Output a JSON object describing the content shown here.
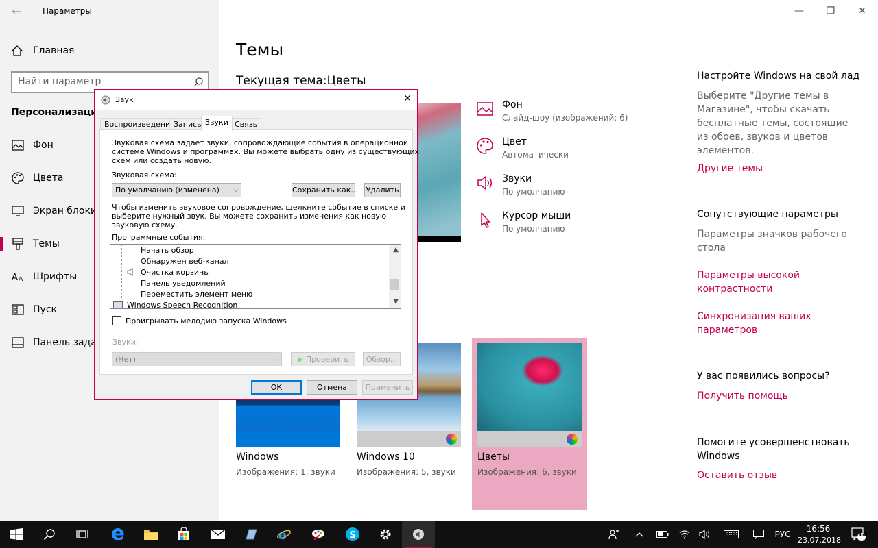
{
  "window": {
    "title": "Параметры",
    "back_glyph": "←",
    "minimize_glyph": "—",
    "maximize_glyph": "❐",
    "close_glyph": "✕"
  },
  "sidebar": {
    "home_label": "Главная",
    "search_placeholder": "Найти параметр",
    "section_title": "Персонализация",
    "items": [
      {
        "label": "Фон",
        "icon": "image-icon"
      },
      {
        "label": "Цвета",
        "icon": "palette-icon"
      },
      {
        "label": "Экран блокировки",
        "icon": "monitor-lock-icon"
      },
      {
        "label": "Темы",
        "icon": "brush-icon",
        "active": true
      },
      {
        "label": "Шрифты",
        "icon": "font-icon"
      },
      {
        "label": "Пуск",
        "icon": "start-icon"
      },
      {
        "label": "Панель задач",
        "icon": "taskbar-icon"
      }
    ]
  },
  "main": {
    "title": "Темы",
    "current_theme": "Текущая тема:Цветы",
    "properties": [
      {
        "title": "Фон",
        "sub": "Слайд-шоу (изображений: 6)",
        "icon": "image-icon"
      },
      {
        "title": "Цвет",
        "sub": "Автоматически",
        "icon": "palette-icon"
      },
      {
        "title": "Звуки",
        "sub": "По умолчанию",
        "icon": "speaker-icon"
      },
      {
        "title": "Курсор мыши",
        "sub": "По умолчанию",
        "icon": "cursor-icon"
      }
    ],
    "themes": [
      {
        "name": "Windows",
        "desc": "Изображения: 1, звуки"
      },
      {
        "name": "Windows 10",
        "desc": "Изображения: 5, звуки"
      },
      {
        "name": "Цветы",
        "desc": "Изображения: 6, звуки",
        "selected": true
      }
    ]
  },
  "right": {
    "customize_head": "Настройте Windows на свой лад",
    "customize_text": "Выберите \"Другие темы в Магазине\", чтобы скачать бесплатные темы, состоящие из обоев, звуков и цветов элементов.",
    "more_themes_link": "Другие темы",
    "related_head": "Сопутствующие параметры",
    "desktop_icons_text": "Параметры значков рабочего стола",
    "high_contrast_link": "Параметры высокой контрастности",
    "sync_link": "Синхронизация ваших параметров",
    "questions_head": "У вас появились вопросы?",
    "help_link": "Получить помощь",
    "improve_head": "Помогите усовершенствовать Windows",
    "feedback_link": "Оставить отзыв"
  },
  "dialog": {
    "title": "Звук",
    "close_glyph": "✕",
    "tabs": [
      "Воспроизведение",
      "Запись",
      "Звуки",
      "Связь"
    ],
    "active_tab": 2,
    "intro_lines": [
      "Звуковая схема задает звуки, сопровождающие события в операционной",
      "системе Windows и программах. Вы можете выбрать одну из существующих",
      "схем или создать новую."
    ],
    "scheme_label": "Звуковая схема:",
    "scheme_value": "По умолчанию (изменена)",
    "save_as_button": "Сохранить как...",
    "delete_button": "Удалить",
    "instructions_lines": [
      "Чтобы изменить звуковое сопровождение, щелкните событие в списке и",
      "выберите нужный звук. Вы можете сохранить изменения как новую",
      "звуковую схему."
    ],
    "events_label": "Программные события:",
    "events": [
      "Начать обзор",
      "Обнаружен веб-канал",
      "Очистка корзины",
      "Панель уведомлений",
      "Переместить элемент меню",
      "Windows Speech Recognition"
    ],
    "startup_checkbox_label": "Проигрывать мелодию запуска Windows",
    "startup_checked": false,
    "sounds_label": "Звуки:",
    "sounds_value": "(Нет)",
    "test_button": "Проверить",
    "browse_button": "Обзор...",
    "ok_button": "ОК",
    "cancel_button": "Отмена",
    "apply_button": "Применить"
  },
  "taskbar": {
    "language": "РУС",
    "time": "16:56",
    "date": "23.07.2018",
    "notification_count": "14",
    "colors": {
      "accent": "#c30052",
      "background": "#101010"
    }
  },
  "colors": {
    "accent": "#c30052",
    "sidebar_bg": "#f2f2f2",
    "selected_theme_bg": "#eaa8c1"
  }
}
